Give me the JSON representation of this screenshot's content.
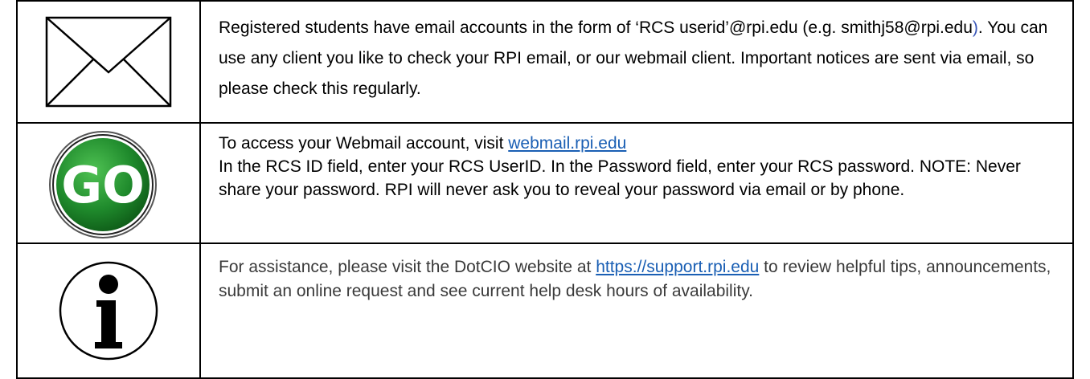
{
  "rows": [
    {
      "icon": "envelope-icon",
      "text_before": "Registered students have email accounts in the form of ‘RCS userid’@rpi.edu (e.g. smithj58@rpi.edu",
      "paren": ")",
      "text_after": ".  You can use any client you like to check your RPI email, or our webmail client.  Important notices are sent via email, so please check this regularly."
    },
    {
      "icon": "go-icon",
      "icon_label": "GO",
      "intro": "To access your Webmail account, visit ",
      "link": "webmail.rpi.edu",
      "body": "In the RCS ID field, enter your RCS UserID. In the Password field, enter your RCS password. NOTE: Never share your password. RPI will never ask you to reveal your password via email or by phone."
    },
    {
      "icon": "info-icon",
      "text_before": "For assistance, please visit the DotCIO website at ",
      "link": "https://support.rpi.edu",
      "text_after": " to review helpful tips, announcements, submit an online request and see current help desk hours of availability."
    }
  ],
  "colors": {
    "link": "#1a5fb4",
    "go_green": "#1f8a2c",
    "border": "#000000"
  }
}
